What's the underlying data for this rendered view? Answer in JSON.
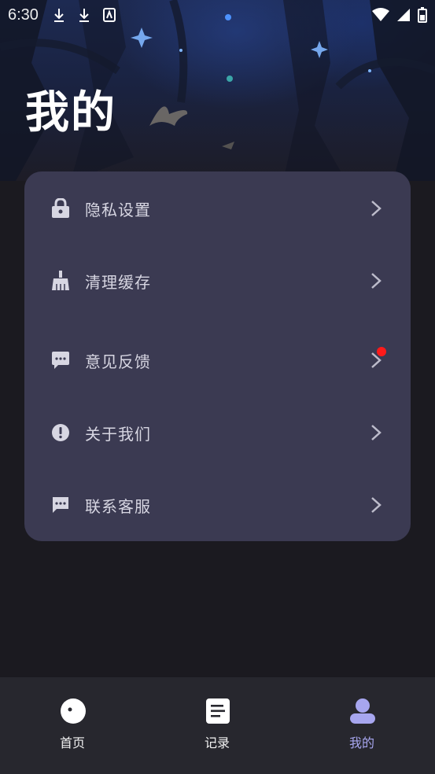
{
  "status_bar": {
    "time": "6:30"
  },
  "page": {
    "title": "我的"
  },
  "menu": [
    {
      "label": "隐私设置",
      "icon": "lock-icon"
    },
    {
      "label": "清理缓存",
      "icon": "broom-icon"
    },
    {
      "label": "意见反馈",
      "icon": "feedback-icon",
      "badge_dot": true
    },
    {
      "label": "关于我们",
      "icon": "info-icon"
    },
    {
      "label": "联系客服",
      "icon": "chat-icon"
    }
  ],
  "tabbar": {
    "tabs": [
      {
        "label": "首页",
        "icon": "moon-icon"
      },
      {
        "label": "记录",
        "icon": "document-icon"
      },
      {
        "label": "我的",
        "icon": "user-icon",
        "active": true
      }
    ]
  },
  "colors": {
    "background": "#1b1a20",
    "card": "#3b3a52",
    "tabbar": "#27272e",
    "active_tab": "#a7a6ef",
    "badge": "#ff1a1a"
  }
}
